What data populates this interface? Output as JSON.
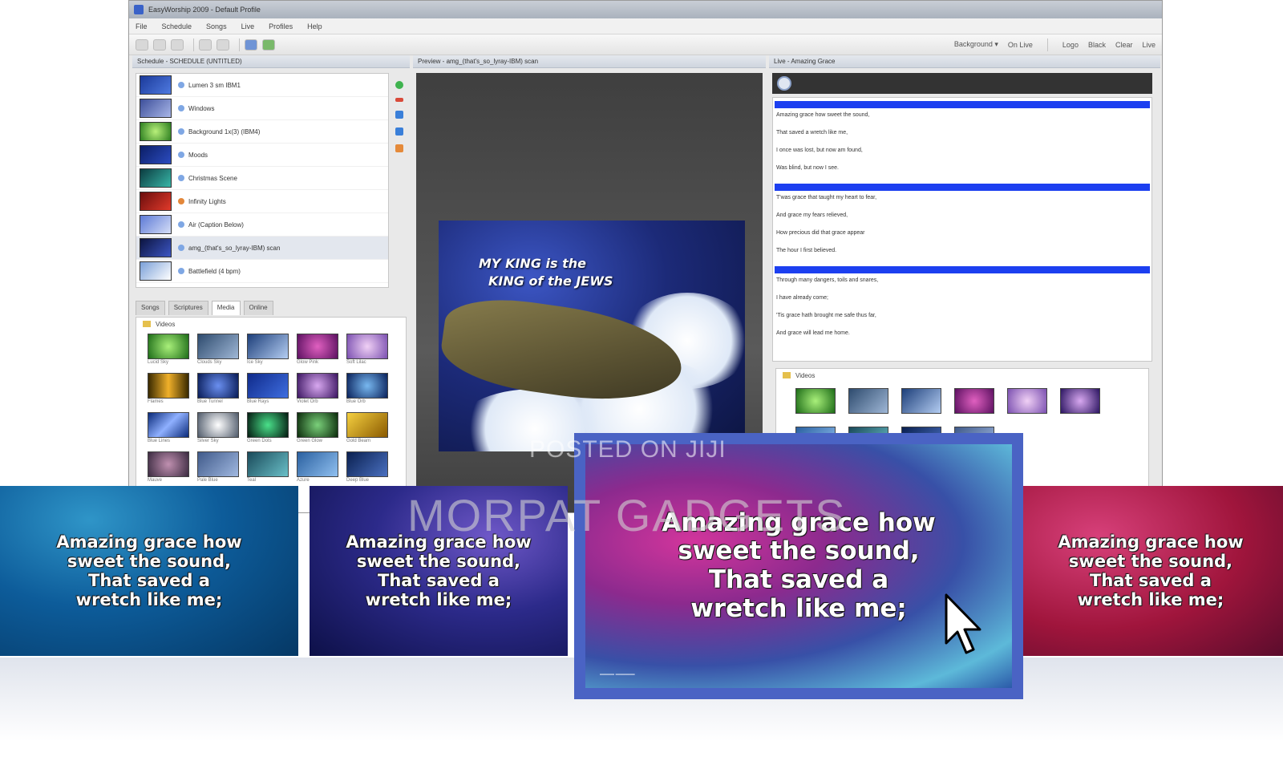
{
  "app": {
    "title": "EasyWorship 2009 - Default Profile",
    "menu": [
      "File",
      "Schedule",
      "Songs",
      "Live",
      "Profiles",
      "Help"
    ],
    "toolbar": {
      "background_label": "Background ▾",
      "on_live_label": "On Live",
      "logo_label": "Logo",
      "black_label": "Black",
      "clear_label": "Clear",
      "live_label": "Live"
    }
  },
  "schedule": {
    "header": "Schedule - SCHEDULE (UNTITLED)",
    "items": [
      {
        "label": "Lumen 3 sm IBM1"
      },
      {
        "label": "Windows"
      },
      {
        "label": "Background 1x(3) (IBM4)"
      },
      {
        "label": "Moods"
      },
      {
        "label": "Christmas Scene"
      },
      {
        "label": "Infinity Lights"
      },
      {
        "label": "Air (Caption Below)"
      },
      {
        "label": "amg_(that's_so_lyray-IBM) scan"
      },
      {
        "label": "Battlefield (4 bpm)"
      }
    ]
  },
  "media": {
    "tabs": [
      "Songs",
      "Scriptures",
      "Media",
      "Online"
    ],
    "folder_label": "Videos",
    "captions": [
      "Lucid Sky",
      "Clouds Sky",
      "Ice Sky",
      "Glow Pink",
      "Soft Lilac",
      "Flames",
      "Blue Tunnel",
      "Blue Rays",
      "Violet Orb",
      "Blue Orb",
      "Blue Lines",
      "Silver Sky",
      "Green Dots",
      "Green Glow",
      "Gold Beam",
      "Mauve",
      "Pale Blue",
      "Teal",
      "Azure",
      "Deep Blue"
    ]
  },
  "preview": {
    "header": "Preview - amg_(that's_so_lyray-IBM) scan",
    "slide_line1": "MY KING is the",
    "slide_line2": "KING of the JEWS"
  },
  "live": {
    "header": "Live - Amazing Grace",
    "lyric_lines": [
      "Amazing grace how sweet the sound,",
      "That saved a wretch like me,",
      "I once was lost, but now am found,",
      "Was blind, but now I see.",
      "T'was grace that taught my heart to fear,",
      "And grace my fears relieved,",
      "How precious did that grace appear",
      "The hour I first believed.",
      "Through many dangers, toils and snares,",
      "I have already come;",
      "'Tis grace hath brought me safe thus far,",
      "And grace will lead me home."
    ],
    "folder_label": "Videos"
  },
  "cards": [
    {
      "text": "Amazing grace how\nsweet the sound,\nThat saved a\nwretch like me;"
    },
    {
      "text": "Amazing grace how\nsweet the sound,\nThat saved a\nwretch like me;"
    },
    {
      "text": "Amazing grace how\nsweet the sound,\nThat saved a\nwretch like me;"
    },
    {
      "text": "Amazing grace how\nsweet the sound,\nThat saved a\nwretch like me;"
    }
  ],
  "watermarks": {
    "small": "POSTED ON JIJI",
    "big": "MORPAT GADGETS"
  },
  "colors": {
    "window_bg": "#e9e9e9",
    "selection_blue": "#1c3ff0",
    "card_border": "#4a63c4"
  }
}
